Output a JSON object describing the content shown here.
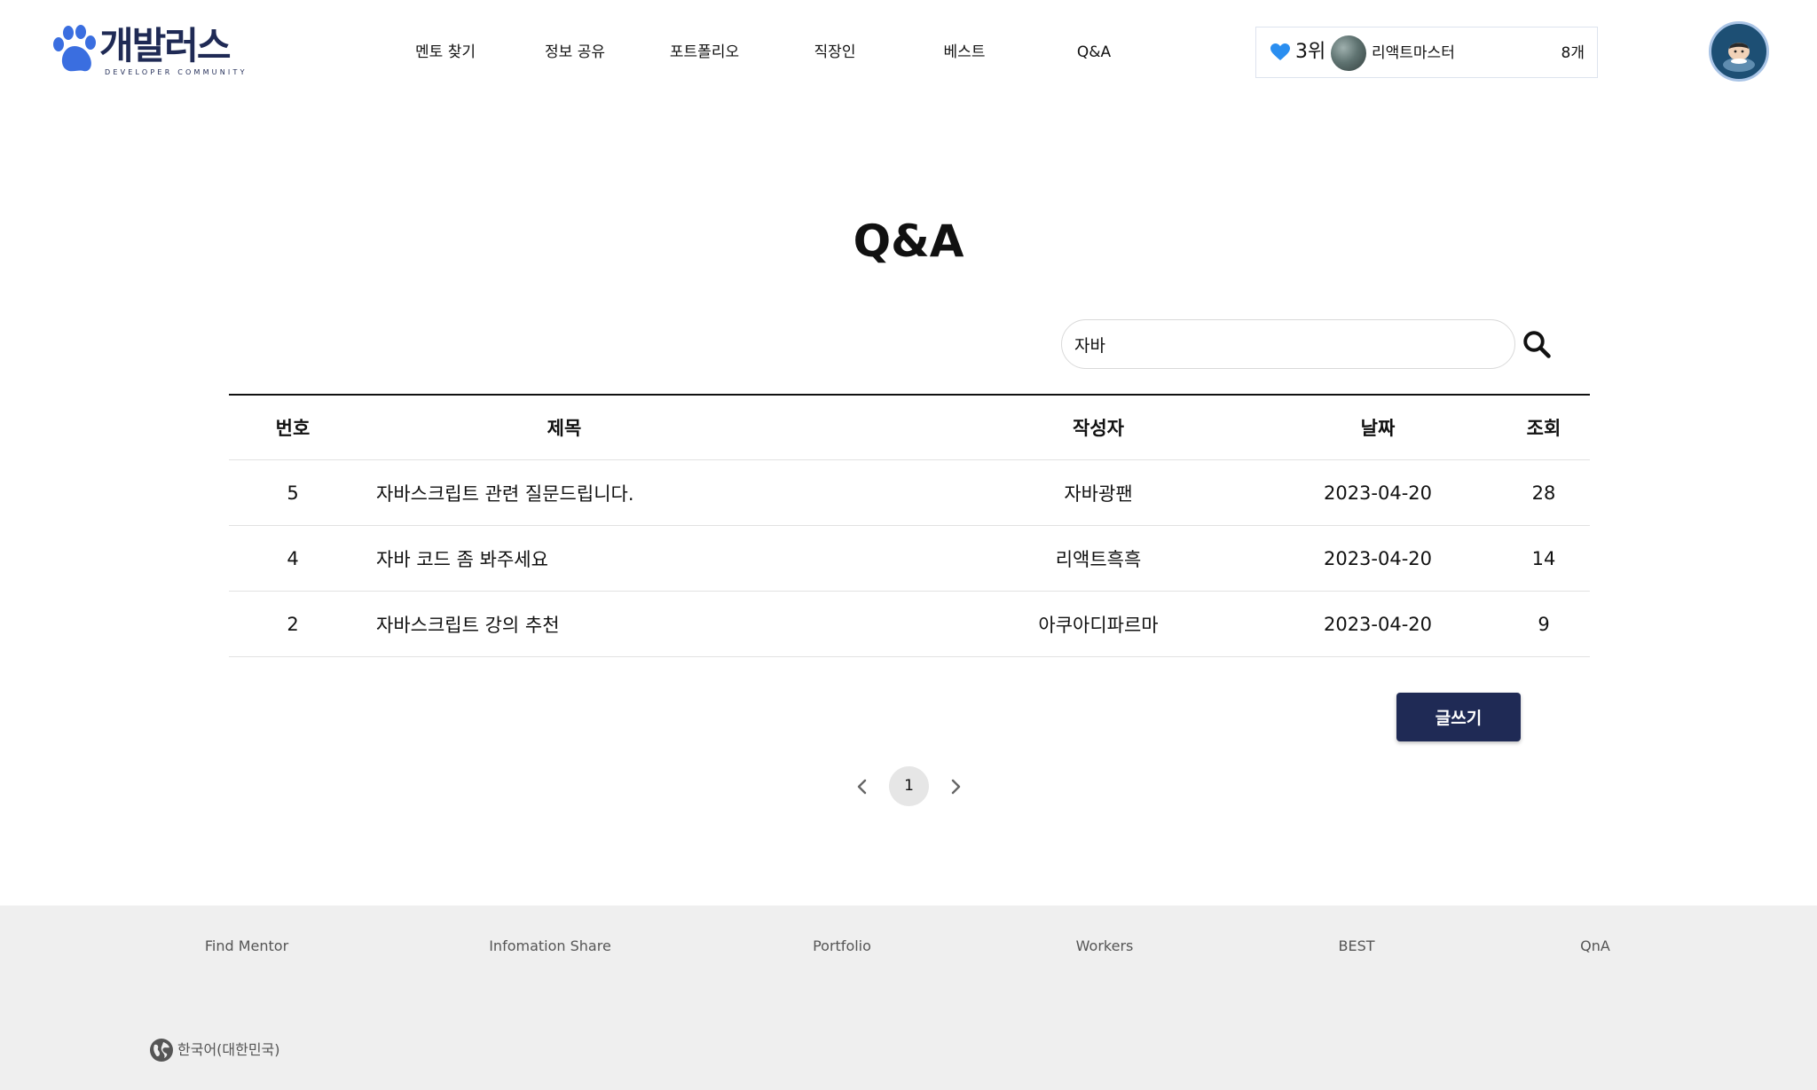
{
  "header": {
    "logo": {
      "title": "개발러스",
      "subtitle": "DEVELOPER COMMUNITY"
    },
    "nav": [
      {
        "label": "멘토 찾기"
      },
      {
        "label": "정보 공유"
      },
      {
        "label": "포트폴리오"
      },
      {
        "label": "직장인"
      },
      {
        "label": "베스트"
      },
      {
        "label": "Q&A"
      }
    ],
    "ranking": {
      "icon": "blue-heart-icon",
      "rank": "3위",
      "username": "리액트마스터",
      "count": "8개"
    }
  },
  "main": {
    "title": "Q&A",
    "search": {
      "value": "자바",
      "icon": "search-icon"
    },
    "table": {
      "columns": [
        "번호",
        "제목",
        "작성자",
        "날짜",
        "조회"
      ],
      "rows": [
        {
          "num": "5",
          "title": "자바스크립트 관련 질문드립니다.",
          "author": "자바광팬",
          "date": "2023-04-20",
          "views": "28"
        },
        {
          "num": "4",
          "title": "자바 코드 좀 봐주세요",
          "author": "리액트흑흑",
          "date": "2023-04-20",
          "views": "14"
        },
        {
          "num": "2",
          "title": "자바스크립트 강의 추천",
          "author": "아쿠아디파르마",
          "date": "2023-04-20",
          "views": "9"
        }
      ]
    },
    "write_button": "글쓰기",
    "pagination": {
      "current": "1"
    }
  },
  "footer": {
    "links": [
      {
        "label": "Find Mentor"
      },
      {
        "label": "Infomation Share"
      },
      {
        "label": "Portfolio"
      },
      {
        "label": "Workers"
      },
      {
        "label": "BEST"
      },
      {
        "label": "QnA"
      }
    ],
    "language": "한국어(대한민국)"
  },
  "colors": {
    "brand_navy": "#1f2a55",
    "brand_blue": "#3a6ee0",
    "footer_bg": "#efefef",
    "heart_blue": "#2a8ef0"
  }
}
